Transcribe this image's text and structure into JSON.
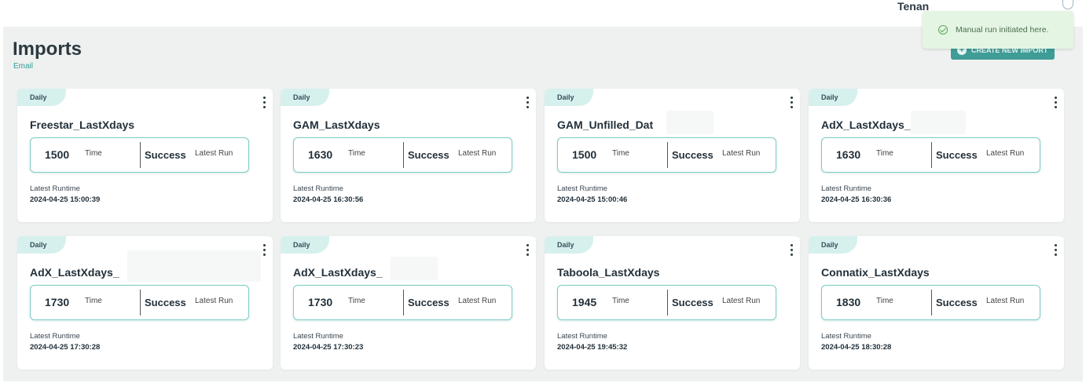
{
  "header": {
    "tenant_label": "Tenan",
    "title": "Imports",
    "subtitle": "Email",
    "create_button_label": "CREATE NEW IMPORT"
  },
  "toast": {
    "message": "Manual run initiated here."
  },
  "cards": [
    {
      "frequency": "Daily",
      "name": "Freestar_LastXdays",
      "time": "1500",
      "time_label": "Time",
      "status": "Success",
      "status_label": "Latest Run",
      "runtime_label": "Latest Runtime",
      "runtime": "2024-04-25 15:00:39"
    },
    {
      "frequency": "Daily",
      "name": "GAM_LastXdays",
      "time": "1630",
      "time_label": "Time",
      "status": "Success",
      "status_label": "Latest Run",
      "runtime_label": "Latest Runtime",
      "runtime": "2024-04-25 16:30:56"
    },
    {
      "frequency": "Daily",
      "name": "GAM_Unfilled_Dat",
      "time": "1500",
      "time_label": "Time",
      "status": "Success",
      "status_label": "Latest Run",
      "runtime_label": "Latest Runtime",
      "runtime": "2024-04-25 15:00:46"
    },
    {
      "frequency": "Daily",
      "name": "AdX_LastXdays_",
      "time": "1630",
      "time_label": "Time",
      "status": "Success",
      "status_label": "Latest Run",
      "runtime_label": "Latest Runtime",
      "runtime": "2024-04-25 16:30:36"
    },
    {
      "frequency": "Daily",
      "name": "AdX_LastXdays_",
      "time": "1730",
      "time_label": "Time",
      "status": "Success",
      "status_label": "Latest Run",
      "runtime_label": "Latest Runtime",
      "runtime": "2024-04-25 17:30:28"
    },
    {
      "frequency": "Daily",
      "name": "AdX_LastXdays_",
      "time": "1730",
      "time_label": "Time",
      "status": "Success",
      "status_label": "Latest Run",
      "runtime_label": "Latest Runtime",
      "runtime": "2024-04-25 17:30:23"
    },
    {
      "frequency": "Daily",
      "name": "Taboola_LastXdays",
      "time": "1945",
      "time_label": "Time",
      "status": "Success",
      "status_label": "Latest Run",
      "runtime_label": "Latest Runtime",
      "runtime": "2024-04-25 19:45:32"
    },
    {
      "frequency": "Daily",
      "name": "Connatix_LastXdays",
      "time": "1830",
      "time_label": "Time",
      "status": "Success",
      "status_label": "Latest Run",
      "runtime_label": "Latest Runtime",
      "runtime": "2024-04-25 18:30:28"
    }
  ],
  "colors": {
    "accent": "#3f9d97",
    "badge_bg": "#d6f0ed",
    "toast_bg": "#e4f5e4",
    "page_bg": "#eff1f0"
  }
}
